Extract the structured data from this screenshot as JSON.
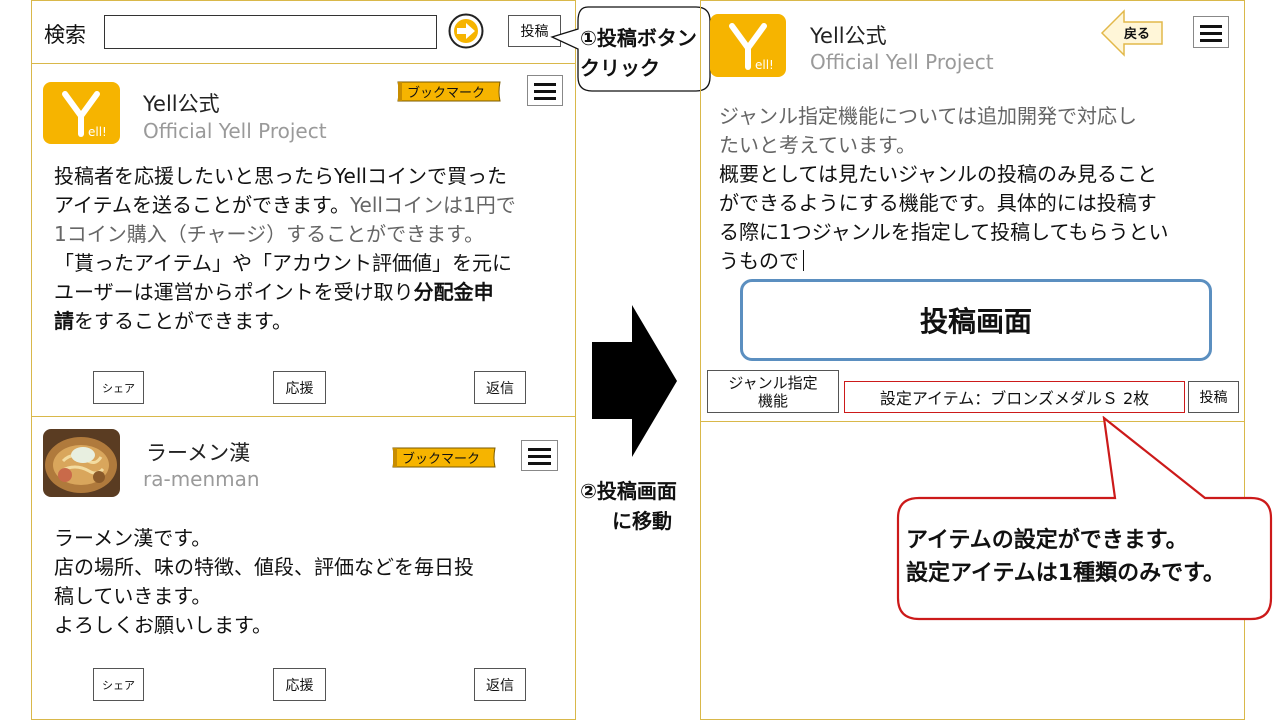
{
  "left": {
    "search": {
      "label": "検索",
      "value": ""
    },
    "post_button": "投稿",
    "posts": [
      {
        "account_name": "Yell公式",
        "account_sub": "Official Yell Project",
        "bookmark": "ブックマーク",
        "body_l1": "投稿者を応援したいと思ったらYellコインで買った",
        "body_l2a": "アイテムを送ることができます。",
        "body_l2b": "Yellコインは1円で",
        "body_l3": "1コイン購入（チャージ）することができます。",
        "body_l4": "「貰ったアイテム」や「アカウント評価値」を元に",
        "body_l5a": "ユーザーは運営からポイントを受け取り",
        "body_l5b": "分配金申",
        "body_l6a": "請",
        "body_l6b": "をすることができます。",
        "actions": {
          "share": "シェア",
          "support": "応援",
          "reply": "返信"
        }
      },
      {
        "account_name": "ラーメン漢",
        "account_sub": "ra-menman",
        "bookmark": "ブックマーク",
        "body_l1": "ラーメン漢です。",
        "body_l2": "店の場所、味の特徴、値段、評価などを毎日投",
        "body_l3": "稿していきます。",
        "body_l4": "よろしくお願いします。",
        "actions": {
          "share": "シェア",
          "support": "応援",
          "reply": "返信"
        }
      }
    ]
  },
  "annotations": {
    "step1_l1": "①投稿ボタン",
    "step1_l2": "クリック",
    "step2_l1": "②投稿画面",
    "step2_l2": "に移動",
    "item_note_l1": "アイテムの設定ができます。",
    "item_note_l2": "設定アイテムは1種類のみです。"
  },
  "right": {
    "account_name": "Yell公式",
    "account_sub": "Official Yell Project",
    "back": "戻る",
    "compose_l1": "ジャンル指定機能については追加開発で対応し",
    "compose_l2": "たいと考えています。",
    "compose_l3": "概要としては見たいジャンルの投稿のみ見ること",
    "compose_l4": "ができるようにする機能です。具体的には投稿す",
    "compose_l5": "る際に1つジャンルを指定して投稿してもらうとい",
    "compose_l6": "うもので",
    "screen_title": "投稿画面",
    "genre_l1": "ジャンル指定",
    "genre_l2": "機能",
    "item_setting": "設定アイテム：ブロンズメダルＳ 2枚",
    "post": "投稿"
  },
  "colors": {
    "brand": "#f6b400",
    "border": "#d9b84a",
    "callout": "#cc1a1a",
    "screen_box": "#5b8fc0"
  },
  "icons": [
    "arrow-right-circle-icon",
    "hamburger-menu-icon",
    "bookmark-ribbon-icon",
    "back-arrow-icon",
    "big-right-arrow-icon"
  ]
}
